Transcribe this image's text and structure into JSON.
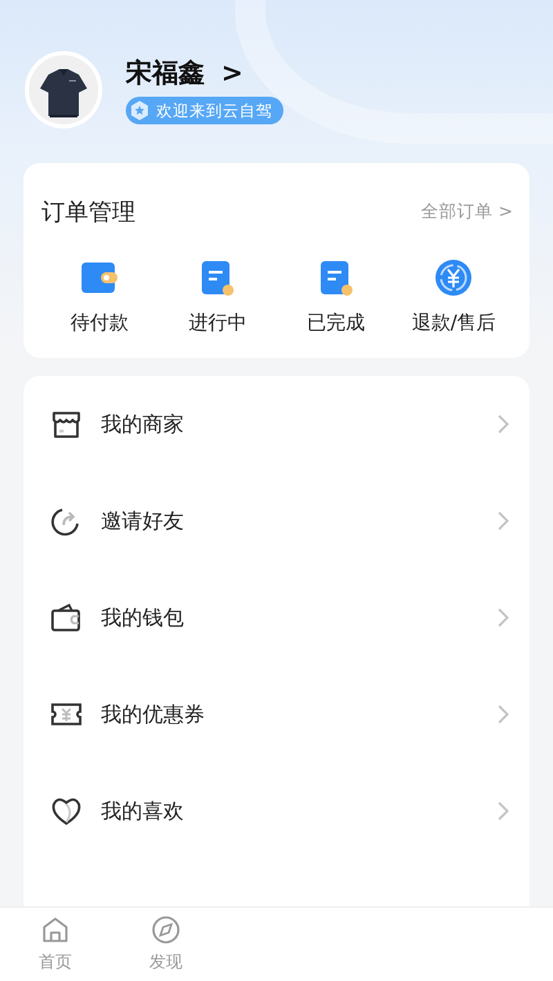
{
  "profile": {
    "name": "宋福鑫",
    "name_arrow": ">",
    "badge": "欢迎来到云自驾"
  },
  "orders": {
    "title": "订单管理",
    "all_link": "全部订单",
    "all_arrow": ">",
    "items": [
      {
        "label": "待付款",
        "kind": "wallet"
      },
      {
        "label": "进行中",
        "kind": "note"
      },
      {
        "label": "已完成",
        "kind": "note"
      },
      {
        "label": "退款/售后",
        "kind": "refund"
      }
    ]
  },
  "menu": [
    {
      "label": "我的商家",
      "kind": "shop"
    },
    {
      "label": "邀请好友",
      "kind": "invite"
    },
    {
      "label": "我的钱包",
      "kind": "wallet"
    },
    {
      "label": "我的优惠券",
      "kind": "coupon"
    },
    {
      "label": "我的喜欢",
      "kind": "heart"
    }
  ],
  "tabs": [
    {
      "label": "首页",
      "kind": "home"
    },
    {
      "label": "发现",
      "kind": "discover"
    }
  ]
}
